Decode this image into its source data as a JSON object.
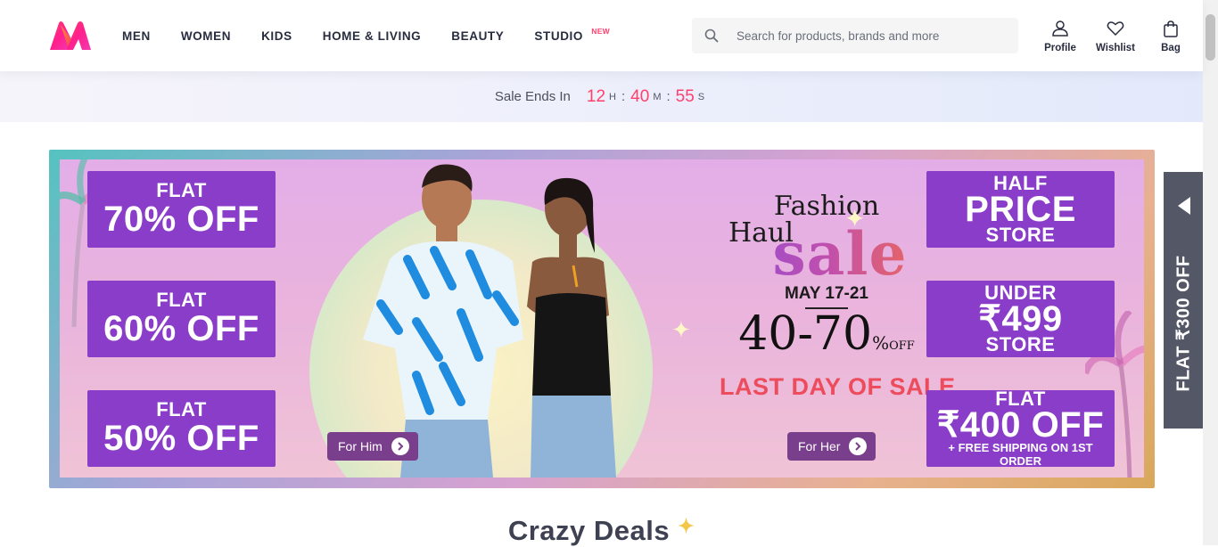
{
  "header": {
    "nav": [
      {
        "label": "MEN"
      },
      {
        "label": "WOMEN"
      },
      {
        "label": "KIDS"
      },
      {
        "label": "HOME & LIVING"
      },
      {
        "label": "BEAUTY"
      },
      {
        "label": "STUDIO",
        "badge": "NEW"
      }
    ],
    "search": {
      "placeholder": "Search for products, brands and more",
      "icon": "search-icon"
    },
    "actions": [
      {
        "label": "Profile",
        "icon": "person-icon"
      },
      {
        "label": "Wishlist",
        "icon": "heart-icon"
      },
      {
        "label": "Bag",
        "icon": "bag-icon"
      }
    ]
  },
  "timer": {
    "label": "Sale Ends In",
    "hours": "12",
    "hours_unit": "H",
    "minutes": "40",
    "minutes_unit": "M",
    "seconds": "55",
    "seconds_unit": "S"
  },
  "banner": {
    "left_offers": [
      {
        "line1": "FLAT",
        "line2": "70% OFF"
      },
      {
        "line1": "FLAT",
        "line2": "60% OFF"
      },
      {
        "line1": "FLAT",
        "line2": "50% OFF"
      }
    ],
    "right_offers": [
      {
        "line1": "HALF",
        "line2": "PRICE",
        "line3": "STORE"
      },
      {
        "line1": "UNDER",
        "line2": "₹499",
        "line3": "STORE"
      },
      {
        "line1": "FLAT",
        "line2": "₹400 OFF",
        "line3": "+ FREE SHIPPING ON 1ST ORDER"
      }
    ],
    "headline": {
      "line1": "Fashion",
      "line2": "Haul",
      "sale": "sale",
      "dates": "MAY 17-21",
      "range": "40-70",
      "pct_sign": "%",
      "pct_off": "OFF",
      "cta": "LAST DAY OF SALE"
    },
    "for_him": "For Him",
    "for_her": "For Her"
  },
  "side_tab": {
    "label": "FLAT ₹300 OFF"
  },
  "section": {
    "title": "Crazy Deals"
  },
  "colors": {
    "brand": "#ff3f6c",
    "offer_bg": "#8a3dc8",
    "side_tab_bg": "#535766"
  }
}
